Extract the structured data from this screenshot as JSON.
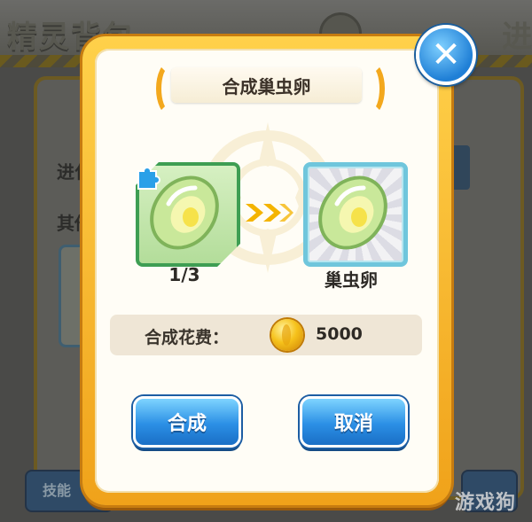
{
  "background": {
    "title": "精灵背包",
    "title_right": "进",
    "row1_label": "进化",
    "row2_label": "其他",
    "skill_button_label": "技能"
  },
  "dialog": {
    "title": "合成巢虫卵",
    "source_item": {
      "icon": "egg-icon",
      "badge_icon": "puzzle-piece-icon",
      "count": "1/3"
    },
    "result_item": {
      "icon": "egg-icon",
      "name": "巢虫卵"
    },
    "cost": {
      "label": "合成花费：",
      "currency_icon": "gold-coin-icon",
      "amount": "5000"
    },
    "buttons": {
      "confirm": "合成",
      "cancel": "取消"
    },
    "close_icon": "close-icon"
  },
  "watermark": "游戏狗",
  "colors": {
    "frame_gold": "#f0a21a",
    "button_blue": "#2b8fe5",
    "source_green": "#3e9e53",
    "result_blue": "#6fc6dc",
    "arrow_yellow": "#f4b400"
  }
}
